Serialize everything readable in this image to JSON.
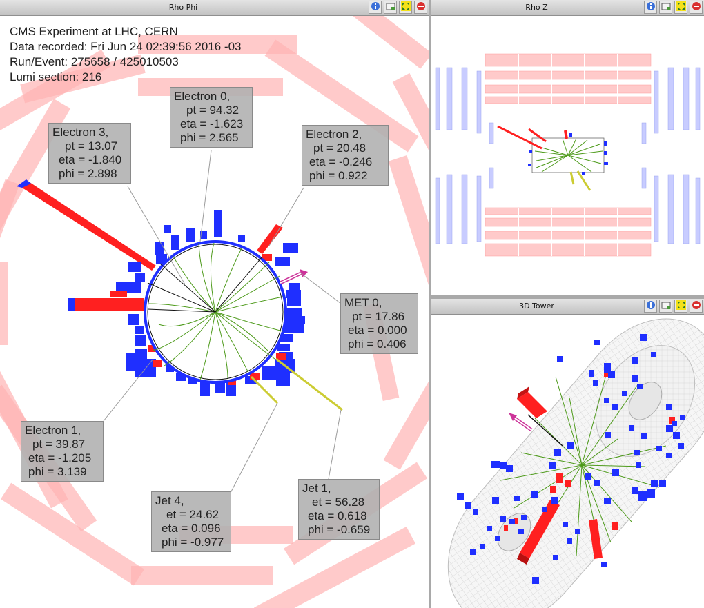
{
  "panels": {
    "rho_phi": {
      "title": "Rho Phi",
      "hud": {
        "line1": "CMS Experiment at LHC, CERN",
        "line2": "Data recorded: Fri Jun 24 02:39:56 2016 -03",
        "line3": "Run/Event: 275658 / 425010503",
        "line4": "Lumi section: 216"
      },
      "labels": {
        "electron0": {
          "name": "Electron 0,",
          "l1": "pt = 94.32",
          "l2": "eta = -1.623",
          "l3": "phi = 2.565"
        },
        "electron1": {
          "name": "Electron 1,",
          "l1": "pt = 39.87",
          "l2": "eta = -1.205",
          "l3": "phi = 3.139"
        },
        "electron2": {
          "name": "Electron 2,",
          "l1": "pt = 20.48",
          "l2": "eta = -0.246",
          "l3": "phi = 0.922"
        },
        "electron3": {
          "name": "Electron 3,",
          "l1": "pt = 13.07",
          "l2": "eta = -1.840",
          "l3": "phi = 2.898"
        },
        "met0": {
          "name": "MET 0,",
          "l1": "pt = 17.86",
          "l2": "eta = 0.000",
          "l3": "phi = 0.406"
        },
        "jet1": {
          "name": "Jet 1,",
          "l1": "et = 56.28",
          "l2": "eta = 0.618",
          "l3": "phi = -0.659"
        },
        "jet4": {
          "name": "Jet 4,",
          "l1": "et = 24.62",
          "l2": "eta = 0.096",
          "l3": "phi = -0.977"
        }
      }
    },
    "rho_z": {
      "title": "Rho Z"
    },
    "tower_3d": {
      "title": "3D Tower"
    }
  },
  "buttons": {
    "info": "info-icon",
    "snapshot": "camera-icon",
    "undock": "maximize-icon",
    "close": "close-icon"
  },
  "colors": {
    "muon_chambers": "#ffb3b3",
    "ecal_energy": "#ff2020",
    "hcal_energy": "#1f2fff",
    "tracks": "#4d9a1a",
    "jets": "#cccc33",
    "met": "#cc3399"
  }
}
